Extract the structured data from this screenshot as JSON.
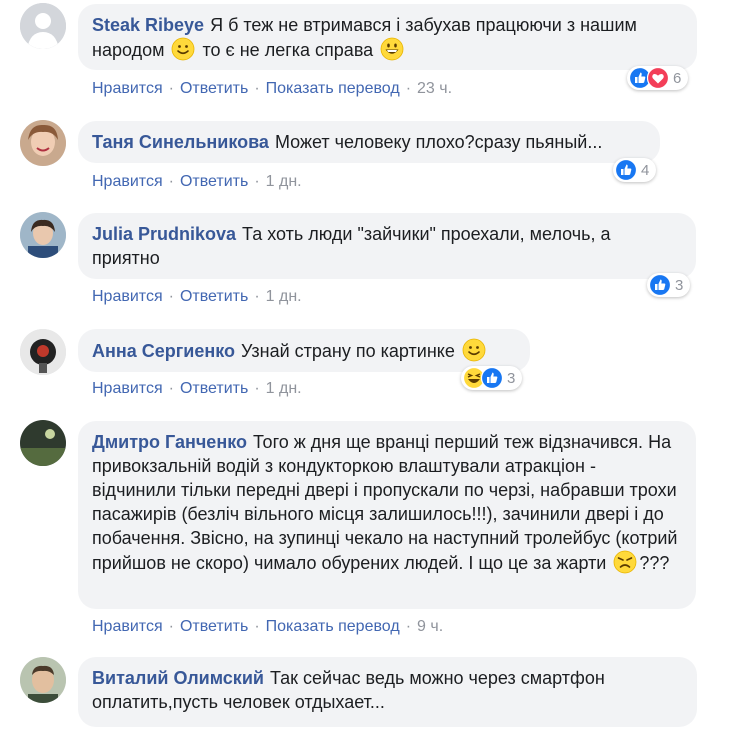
{
  "actions": {
    "like": "Нравится",
    "reply": "Ответить",
    "translate": "Показать перевод",
    "sep": "·"
  },
  "colors": {
    "author": "#385898",
    "link": "#4267b2",
    "bubble": "#f2f3f5",
    "like_blue": "#1877f2",
    "love_red": "#f33e58"
  },
  "comments": [
    {
      "author": "Steak Ribeye",
      "text_a": "Я б теж не втримався і забухав працюючи з нашим народом",
      "text_b": "то є не легка справа",
      "emojis": [
        "slightly-smiling-emoji",
        "grinning-emoji"
      ],
      "time": "23 ч.",
      "has_translate": true,
      "reactions": [
        "like-icon",
        "love-icon"
      ],
      "reaction_count": "6"
    },
    {
      "author": "Таня Синельникова",
      "text": "Может человеку плохо?сразу пьяный...",
      "time": "1 дн.",
      "has_translate": false,
      "reactions": [
        "like-icon"
      ],
      "reaction_count": "4"
    },
    {
      "author": "Julia Prudnikova",
      "text": "Та хоть люди \"зайчики\" проехали, мелочь, а приятно",
      "time": "1 дн.",
      "has_translate": false,
      "reactions": [
        "like-icon"
      ],
      "reaction_count": "3"
    },
    {
      "author": "Анна Сергиенко",
      "text": "Узнай страну по картинке",
      "emojis": [
        "slightly-smiling-emoji"
      ],
      "time": "1 дн.",
      "has_translate": false,
      "reactions": [
        "haha-icon",
        "like-icon"
      ],
      "reaction_count": "3"
    },
    {
      "author": "Дмитро Ганченко",
      "text_a": "Того ж дня ще вранці перший теж відзначився. На привокзальній водій з кондукторкою влаштували атракціон - відчинили тільки передні двері і пропускали по черзі, набравши трохи пасажирів (безліч вільного місця залишилось!!!), зачинили двері і до побачення. Звісно, на зупинці чекало на наступний тролейбус (котрий прийшов не скоро) чимало обурених людей. І що це за жарти",
      "text_b": "???",
      "emojis": [
        "angry-emoji"
      ],
      "time": "9 ч.",
      "has_translate": true,
      "reactions": [],
      "reaction_count": ""
    },
    {
      "author": "Виталий Олимский",
      "text": "Так сейчас ведь можно через смартфон оплатить,пусть человек отдыхает...",
      "time": "",
      "has_translate": false,
      "reactions": [],
      "reaction_count": ""
    }
  ]
}
